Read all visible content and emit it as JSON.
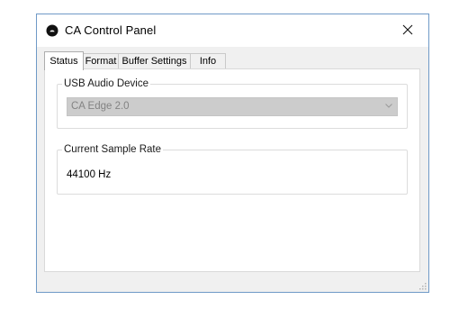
{
  "window": {
    "title": "CA Control Panel",
    "close_glyph": "✕"
  },
  "tabs": [
    {
      "label": "Status",
      "active": true
    },
    {
      "label": "Format",
      "active": false
    },
    {
      "label": "Buffer Settings",
      "active": false
    },
    {
      "label": "Info",
      "active": false
    }
  ],
  "status": {
    "usb_group": {
      "label": "USB Audio Device",
      "selected_device": "CA Edge 2.0",
      "enabled": false
    },
    "rate_group": {
      "label": "Current Sample Rate",
      "value": "44100 Hz"
    }
  },
  "colors": {
    "window_border": "#6f9ac7",
    "client_bg": "#f0f0f0",
    "disabled_combo_bg": "#cccccc",
    "disabled_text": "#838383"
  },
  "icons": {
    "app": "ca-logo-icon",
    "close": "close-icon",
    "dropdown": "chevron-down-icon",
    "grip": "resize-grip-icon"
  }
}
